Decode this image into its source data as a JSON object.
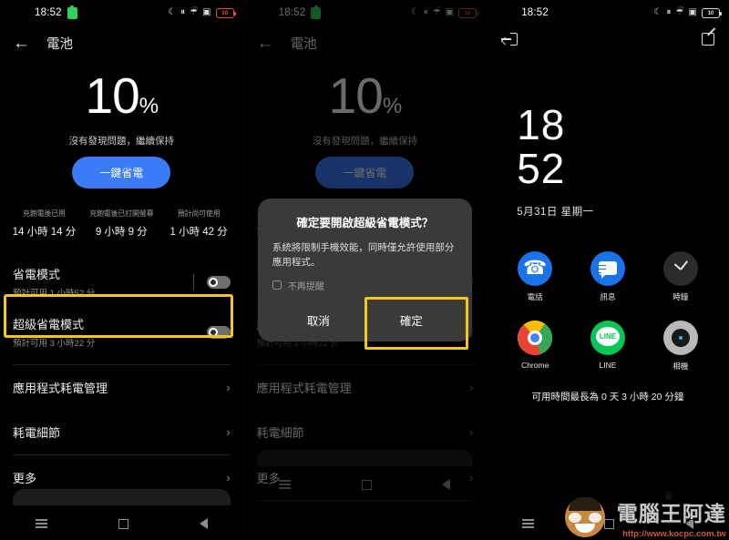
{
  "statusbar": {
    "time": "18:52",
    "icons": [
      "moon-icon",
      "vibrate-icon",
      "wifi-icon",
      "screenshot-icon",
      "battery-icon"
    ],
    "battery_level": "10"
  },
  "panel1": {
    "appbar": {
      "title": "電池",
      "back": "←"
    },
    "hero": {
      "percent": "10",
      "unit": "%",
      "subtitle": "沒有發現問題，繼續保持",
      "button": "一鍵省電"
    },
    "stats": [
      {
        "label": "充飽電後已用",
        "value": "14 小時 14 分"
      },
      {
        "label": "充飽電後已打開螢幕",
        "value": "9 小時 9 分"
      },
      {
        "label": "預計尚可使用",
        "value": "1 小時 42 分"
      }
    ],
    "toggles": [
      {
        "title": "省電模式",
        "sub": "預計可用 1 小時52 分",
        "state": "off"
      },
      {
        "title": "超級省電模式",
        "sub": "預計可用 3 小時22 分",
        "state": "off",
        "highlighted": true
      }
    ],
    "links": [
      {
        "title": "應用程式耗電管理",
        "chevron": "›"
      },
      {
        "title": "耗電細節",
        "chevron": "›"
      },
      {
        "title": "更多",
        "chevron": "›"
      }
    ]
  },
  "panel2": {
    "dialog": {
      "title": "確定要開啟超級省電模式？",
      "body": "系統將限制手機效能，同時僅允許使用部分應用程式。",
      "checkbox_label": "不再提醒",
      "cancel": "取消",
      "confirm": "確定",
      "confirm_highlighted": true
    }
  },
  "panel3": {
    "exit_icon": "exit-icon",
    "edit_icon": "edit-icon",
    "clock": {
      "hours": "18",
      "minutes": "52",
      "date": "5月31日  星期一"
    },
    "apps": [
      {
        "name": "電話",
        "icon": "phone-icon"
      },
      {
        "name": "訊息",
        "icon": "message-icon"
      },
      {
        "name": "時鐘",
        "icon": "clock-icon"
      },
      {
        "name": "Chrome",
        "icon": "chrome-icon"
      },
      {
        "name": "LINE",
        "icon": "line-icon"
      },
      {
        "name": "相機",
        "icon": "camera-icon"
      }
    ],
    "footer": "可用時間最長為 0 天 3 小時 20 分鐘"
  },
  "navbar": {
    "menu": "menu-icon",
    "home": "home-icon",
    "back": "back-icon"
  },
  "watermark": {
    "text": "電腦王阿達",
    "url": "http://www.kocpc.com.tw"
  },
  "colors": {
    "accent_blue": "#3b7bf7",
    "highlight_yellow": "#f5c518",
    "battery_red": "#e04b4b",
    "green_badge": "#30d158"
  }
}
